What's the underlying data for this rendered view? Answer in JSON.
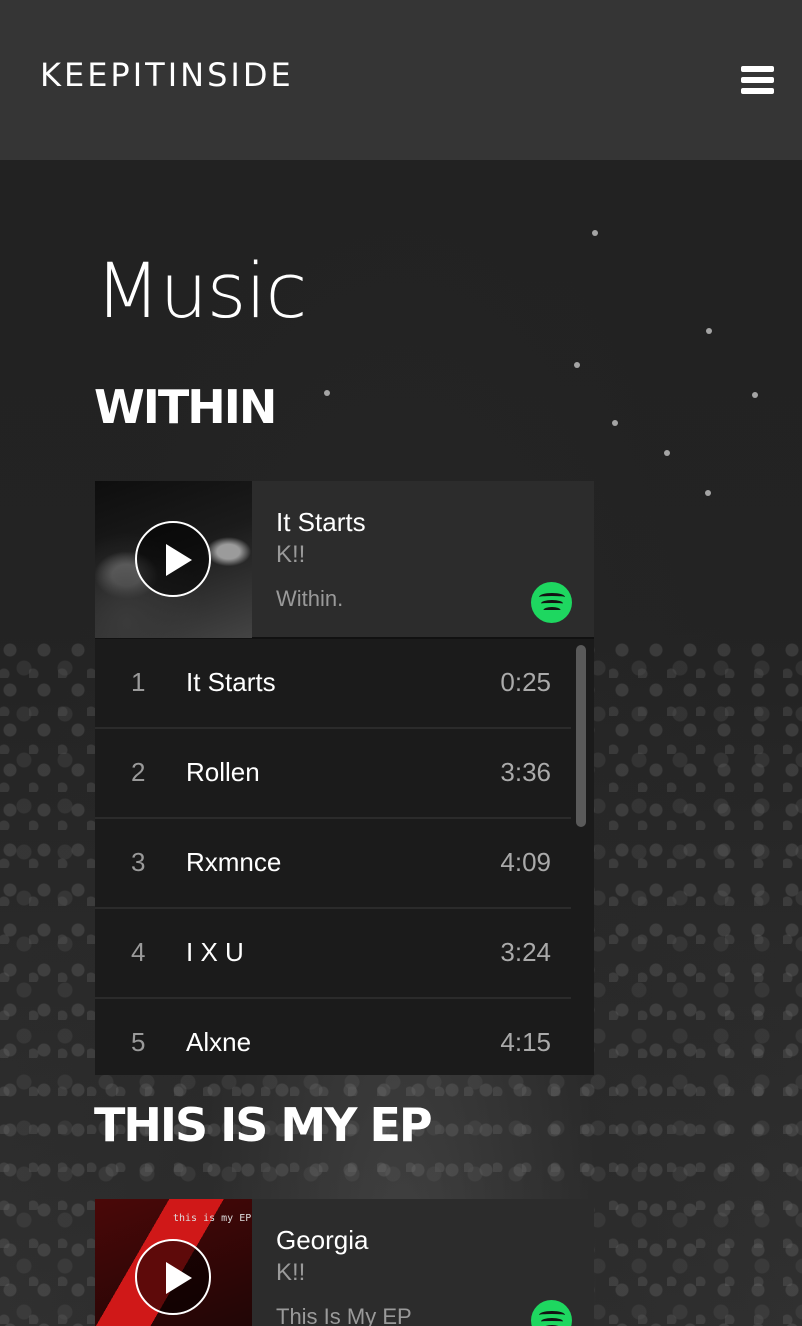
{
  "header": {
    "logo": "KEEPITINSIDE",
    "menu_icon": "hamburger-menu-icon"
  },
  "page": {
    "title": "Music"
  },
  "albums": [
    {
      "title": "WITHIN",
      "player": {
        "track": "It Starts",
        "artist": "K!!",
        "album": "Within.",
        "play_icon": "play-icon",
        "spotify_icon": "spotify-icon",
        "spotify_color": "#1ed760"
      },
      "tracks": [
        {
          "num": "1",
          "name": "It Starts",
          "duration": "0:25"
        },
        {
          "num": "2",
          "name": "Rollen",
          "duration": "3:36"
        },
        {
          "num": "3",
          "name": "Rxmnce",
          "duration": "4:09"
        },
        {
          "num": "4",
          "name": "I X U",
          "duration": "3:24"
        },
        {
          "num": "5",
          "name": "Alxne",
          "duration": "4:15"
        }
      ]
    },
    {
      "title": "THIS IS MY EP",
      "player": {
        "track": "Georgia",
        "artist": "K!!",
        "album": "This Is My EP",
        "cover_text": "this is my EP",
        "play_icon": "play-icon",
        "spotify_icon": "spotify-icon"
      }
    }
  ]
}
